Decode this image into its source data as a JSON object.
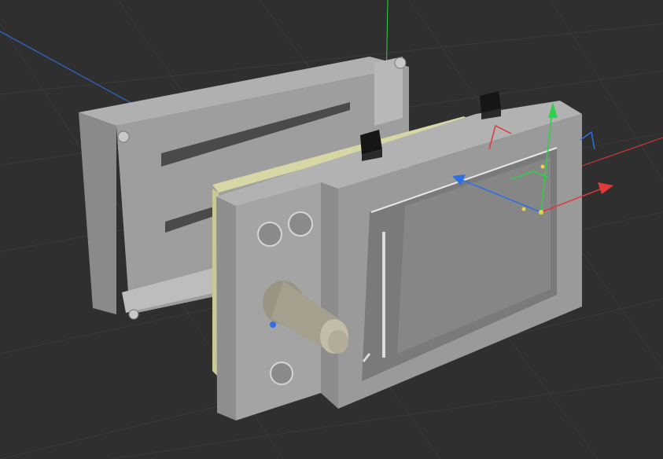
{
  "viewport": {
    "background": "#2f2f2f",
    "grid_color": "#3a3a3a",
    "scene_objects": [
      "rear-mold-plate",
      "front-mold-plate",
      "injection-nozzle",
      "ejector-pins",
      "move-gizmo"
    ]
  },
  "colors": {
    "part_light": "#b0b0b0",
    "part_mid": "#8f8f8f",
    "part_dark": "#6e6e6e",
    "part_shadow": "#4e4e4e",
    "insert_yellow": "#d7d7a6",
    "axis_x": "#e03a3a",
    "axis_y": "#2fd14a",
    "axis_z": "#2f6fe6",
    "connector_black": "#161616"
  },
  "gizmo": {
    "icons": [
      "move-arrow-x-icon",
      "move-arrow-y-icon",
      "move-arrow-z-icon",
      "plane-handle-xy-icon",
      "plane-handle-yz-icon",
      "plane-handle-xz-icon"
    ]
  }
}
